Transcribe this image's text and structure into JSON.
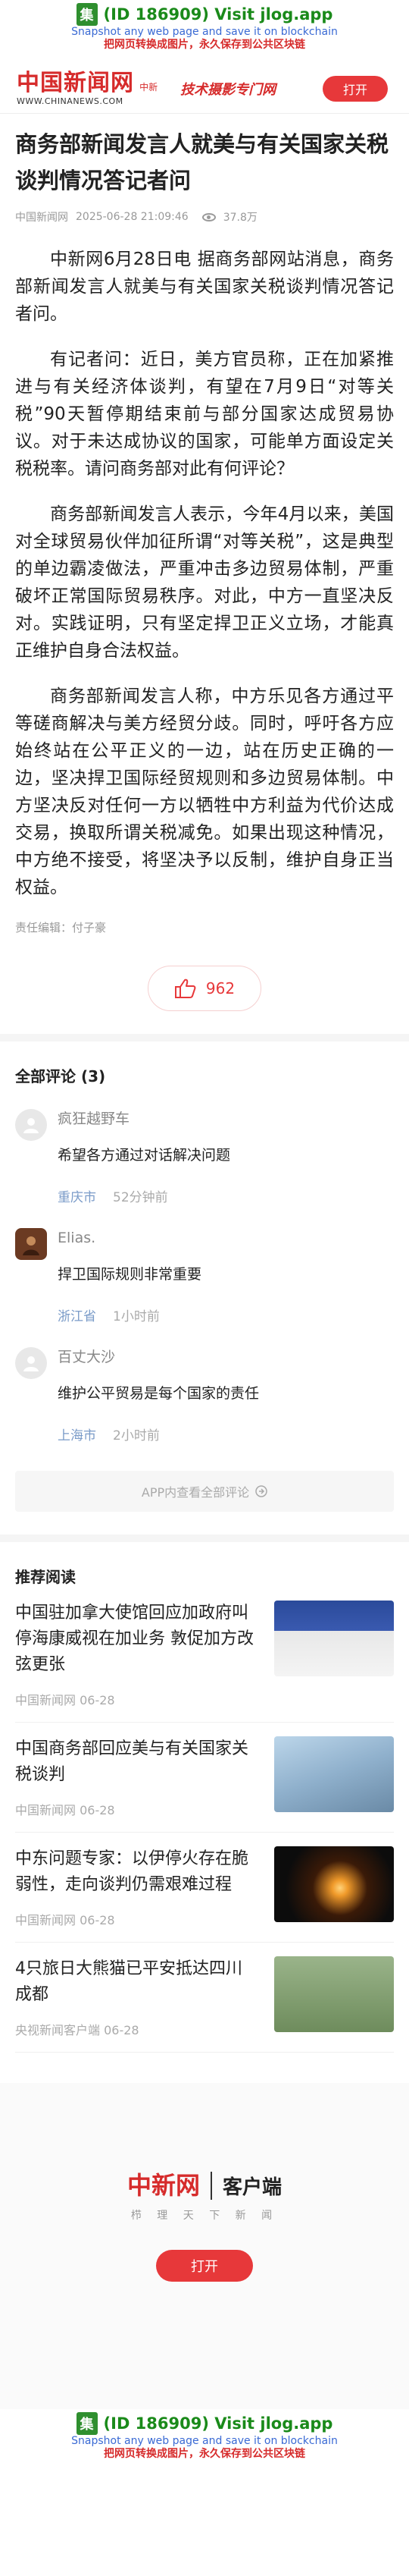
{
  "jlog": {
    "logo": "集",
    "main": "(ID 186909) Visit jlog.app",
    "sub": "Snapshot any web page and save it on blockchain",
    "sub_cn": "把网页转换成图片，永久保存到公共区块链"
  },
  "header": {
    "logo_cn": "中国新闻网",
    "logo_tag": "中新",
    "logo_url": "WWW.CHINANEWS.COM",
    "slogan": "摄影专门网",
    "slogan_prefix": "技术",
    "open_label": "打开"
  },
  "article": {
    "title": "商务部新闻发言人就美与有关国家关税谈判情况答记者问",
    "source": "中国新闻网",
    "datetime": "2025-06-28 21:09:46",
    "views": "37.8万",
    "paragraphs": [
      "中新网6月28日电 据商务部网站消息，商务部新闻发言人就美与有关国家关税谈判情况答记者问。",
      "有记者问：近日，美方官员称，正在加紧推进与有关经济体谈判，有望在7月9日“对等关税”90天暂停期结束前与部分国家达成贸易协议。对于未达成协议的国家，可能单方面设定关税税率。请问商务部对此有何评论？",
      "商务部新闻发言人表示，今年4月以来，美国对全球贸易伙伴加征所谓“对等关税”，这是典型的单边霸凌做法，严重冲击多边贸易体制，严重破坏正常国际贸易秩序。对此，中方一直坚决反对。实践证明，只有坚定捍卫正义立场，才能真正维护自身合法权益。",
      "商务部新闻发言人称，中方乐见各方通过平等磋商解决与美方经贸分歧。同时，呼吁各方应始终站在公平正义的一边，站在历史正确的一边，坚决捍卫国际经贸规则和多边贸易体制。中方坚决反对任何一方以牺牲中方利益为代价达成交易，换取所谓关税减免。如果出现这种情况，中方绝不接受，将坚决予以反制，维护自身正当权益。"
    ],
    "editor": "责任编辑：付子豪",
    "likes": "962"
  },
  "comments": {
    "title": "全部评论 (3)",
    "items": [
      {
        "user": "疯狂越野车",
        "text": "希望各方通过对话解决问题",
        "location": "重庆市",
        "time": "52分钟前"
      },
      {
        "user": "Elias.",
        "text": "捍卫国际规则非常重要",
        "location": "浙江省",
        "time": "1小时前"
      },
      {
        "user": "百丈大沙",
        "text": "维护公平贸易是每个国家的责任",
        "location": "上海市",
        "time": "2小时前"
      }
    ],
    "more": "APP内查看全部评论"
  },
  "recommended": {
    "title": "推荐阅读",
    "items": [
      {
        "title": "中国驻加拿大使馆回应加政府叫停海康威视在加业务 敦促加方改弦更张",
        "source": "中国新闻网",
        "date": "06-28"
      },
      {
        "title": "中国商务部回应美与有关国家关税谈判",
        "source": "中国新闻网",
        "date": "06-28"
      },
      {
        "title": "中东问题专家：以伊停火存在脆弱性，走向谈判仍需艰难过程",
        "source": "中国新闻网",
        "date": "06-28"
      },
      {
        "title": "4只旅日大熊猫已平安抵达四川成都",
        "source": "央视新闻客户端",
        "date": "06-28"
      }
    ]
  },
  "promo": {
    "logo": "中新网",
    "client": "客户端",
    "sub": "栉 理 天 下 新 闻",
    "open_label": "打开"
  }
}
